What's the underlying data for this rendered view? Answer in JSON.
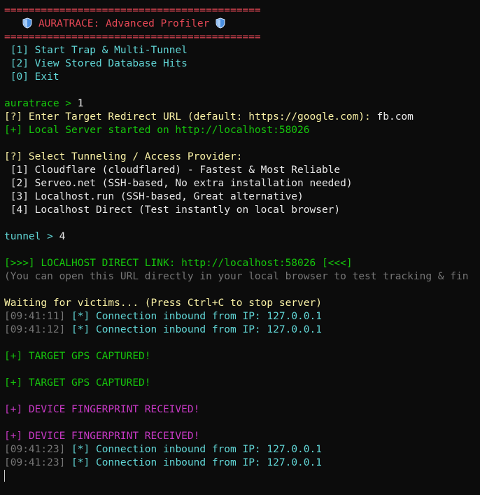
{
  "colors": {
    "background": "#0c0c0c",
    "red": "#e74856",
    "cyan": "#61d6d6",
    "green": "#16c60c",
    "yellow": "#f9f1a5",
    "gray": "#767676",
    "magenta": "#c839c5",
    "white": "#e8e8e8"
  },
  "banner": {
    "rule": "==========================================",
    "title": "AURATRACE: Advanced Profiler",
    "icon": "shield-icon"
  },
  "main_menu": [
    " [1] Start Trap & Multi-Tunnel",
    " [2] View Stored Database Hits",
    " [0] Exit"
  ],
  "prompt1": {
    "label": "auratrace > ",
    "input": "1"
  },
  "redirect": {
    "question": "[?] Enter Target Redirect URL (default: https://google.com): ",
    "answer": "fb.com"
  },
  "server_started": "[+] Local Server started on http://localhost:58026",
  "tunnel_menu": {
    "question": "[?] Select Tunneling / Access Provider:",
    "options": [
      " [1] Cloudflare (cloudflared) - Fastest & Most Reliable",
      " [2] Serveo.net (SSH-based, No extra installation needed)",
      " [3] Localhost.run (SSH-based, Great alternative)",
      " [4] Localhost Direct (Test instantly on local browser)"
    ]
  },
  "prompt2": {
    "label": "tunnel > ",
    "input": "4"
  },
  "direct_link": "[>>>] LOCALHOST DIRECT LINK: http://localhost:58026 [<<<]",
  "hint": "(You can open this URL directly in your local browser to test tracking & fin",
  "waiting": "Waiting for victims... (Press Ctrl+C to stop server)",
  "log": [
    {
      "time": "[09:41:11]",
      "msg": " [*] Connection inbound from IP: 127.0.0.1"
    },
    {
      "time": "[09:41:12]",
      "msg": " [*] Connection inbound from IP: 127.0.0.1"
    }
  ],
  "gps_captured": "[+] TARGET GPS CAPTURED!",
  "fingerprint_received": "[+] DEVICE FINGERPRINT RECEIVED!",
  "log2": [
    {
      "time": "[09:41:23]",
      "msg": " [*] Connection inbound from IP: 127.0.0.1"
    },
    {
      "time": "[09:41:23]",
      "msg": " [*] Connection inbound from IP: 127.0.0.1"
    }
  ]
}
